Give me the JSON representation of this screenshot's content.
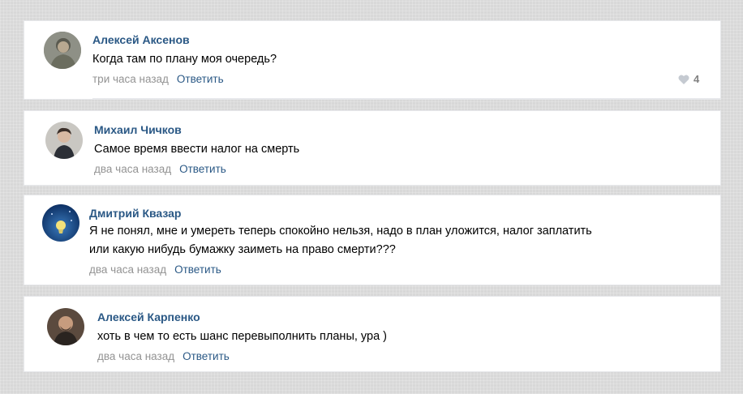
{
  "comments": [
    {
      "author": "Алексей Аксенов",
      "text": "Когда там по плану моя очередь?",
      "time": "три часа назад",
      "reply": "Ответить",
      "likes": "4"
    },
    {
      "author": "Михаил Чичков",
      "text": "Самое время ввести налог на смерть",
      "time": "два часа назад",
      "reply": "Ответить"
    },
    {
      "author": "Дмитрий Квазар",
      "text_line1": "Я не понял, мне и умереть теперь спокойно нельзя, надо в план уложится, налог заплатить",
      "text_line2": "или какую нибудь бумажку заиметь на право смерти???",
      "time": "два часа назад",
      "reply": "Ответить"
    },
    {
      "author": "Алексей Карпенко",
      "text": "хоть в чем то есть шанс перевыполнить планы, ура )",
      "time": "два часа назад",
      "reply": "Ответить"
    }
  ],
  "colors": {
    "link": "#2a5885",
    "meta": "#939393",
    "card": "#ffffff"
  },
  "icons": {
    "like": "heart-icon"
  }
}
